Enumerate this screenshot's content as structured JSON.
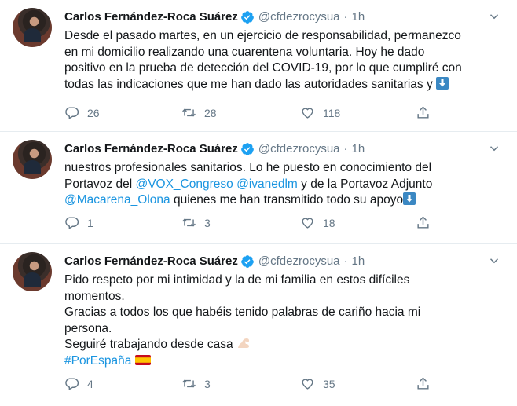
{
  "tweets": [
    {
      "name": "Carlos Fernández-Roca Suárez",
      "handle": "@cfdezrocysua",
      "time": "1h",
      "lines": [
        "Desde el pasado martes, en un ejercicio de responsabilidad, permanezco",
        "en mi domicilio realizando una cuarentena voluntaria. Hoy he dado",
        "positivo en la prueba de detección del COVID-19, por lo que cumpliré con",
        "todas las indicaciones que me han dado las autoridades sanitarias y"
      ],
      "replies": "26",
      "retweets": "28",
      "likes": "118"
    },
    {
      "name": "Carlos Fernández-Roca Suárez",
      "handle": "@cfdezrocysua",
      "time": "1h",
      "line1": "nuestros profesionales sanitarios. Lo he puesto en conocimiento del",
      "line2_pre": "Portavoz del ",
      "mention1": "@VOX_Congreso",
      "mention2": "@ivanedlm",
      "line2_post": " y de la Portavoz Adjunto",
      "mention3": "@Macarena_Olona",
      "line3_post": " quienes me han transmitido todo su apoyo",
      "replies": "1",
      "retweets": "3",
      "likes": "18"
    },
    {
      "name": "Carlos Fernández-Roca Suárez",
      "handle": "@cfdezrocysua",
      "time": "1h",
      "lines": [
        "Pido respeto por mi intimidad y la de mi familia en estos difíciles",
        "momentos.",
        "Gracias a todos los que habéis tenido palabras de cariño hacia mi",
        "persona.",
        "Seguiré trabajando desde casa"
      ],
      "hashtag": "#PorEspaña",
      "replies": "4",
      "retweets": "3",
      "likes": "35"
    }
  ],
  "colors": {
    "accent": "#1b95e0",
    "muted": "#657786",
    "text": "#14171a",
    "divider": "#e6ecf0"
  },
  "icons": [
    "verified-badge-icon",
    "chevron-down-icon",
    "reply-icon",
    "retweet-icon",
    "like-icon",
    "share-icon",
    "down-arrow-emoji-icon",
    "flexed-biceps-emoji-icon",
    "spain-flag-emoji-icon"
  ]
}
